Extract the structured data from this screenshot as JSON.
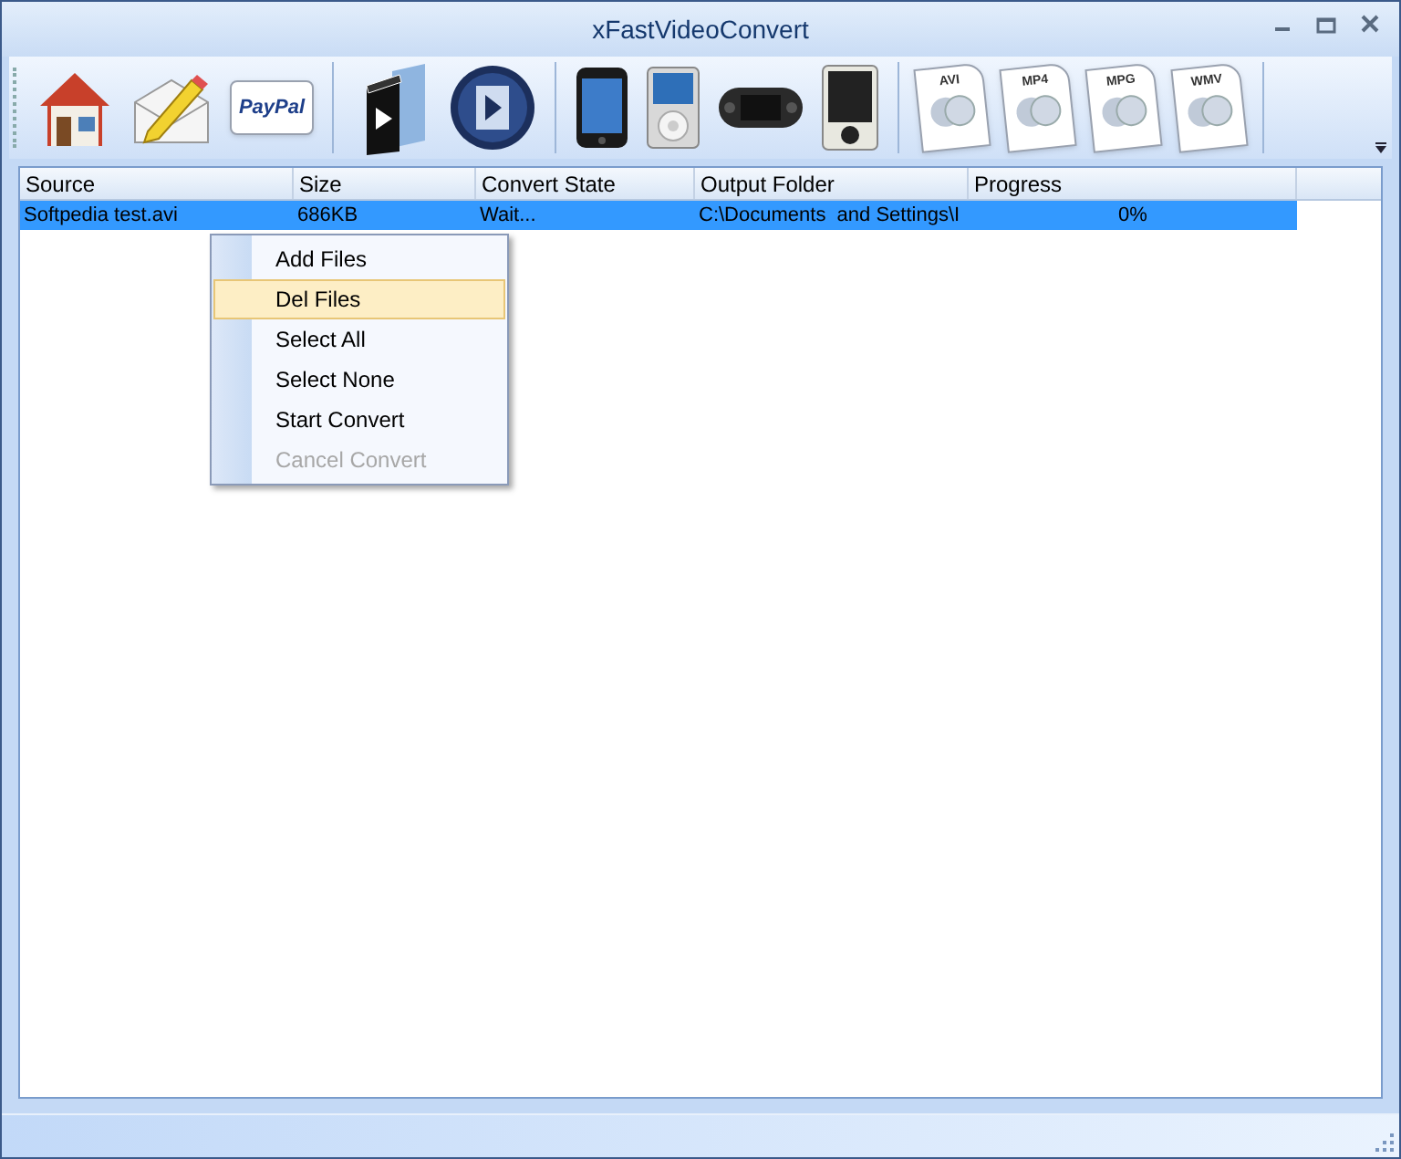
{
  "window": {
    "title": "xFastVideoConvert"
  },
  "toolbar": [
    [
      {
        "kind": "home"
      },
      {
        "kind": "mail"
      },
      {
        "kind": "paypal",
        "label": "PayPal"
      }
    ],
    [
      {
        "kind": "clapper"
      },
      {
        "kind": "play"
      }
    ],
    [
      {
        "kind": "phone"
      },
      {
        "kind": "player"
      },
      {
        "kind": "console"
      },
      {
        "kind": "pda"
      }
    ],
    [
      {
        "kind": "file",
        "label": "AVI"
      },
      {
        "kind": "file",
        "label": "MP4"
      },
      {
        "kind": "file",
        "label": "MPG"
      },
      {
        "kind": "file",
        "label": "WMV"
      }
    ]
  ],
  "table": {
    "columns": [
      "Source",
      "Size",
      "Convert State",
      "Output Folder",
      "Progress"
    ],
    "rows": [
      {
        "selected": true,
        "cells": [
          "Softpedia test.avi",
          "686KB",
          "Wait...",
          "C:\\Documents  and Settings\\I",
          "0%"
        ]
      }
    ]
  },
  "context_menu": [
    {
      "label": "Add Files",
      "selected": false,
      "disabled": false
    },
    {
      "label": "Del Files",
      "selected": true,
      "disabled": false
    },
    {
      "label": "Select All",
      "selected": false,
      "disabled": false
    },
    {
      "label": "Select None",
      "selected": false,
      "disabled": false
    },
    {
      "label": "Start Convert",
      "selected": false,
      "disabled": false
    },
    {
      "label": "Cancel Convert",
      "selected": false,
      "disabled": true
    }
  ]
}
